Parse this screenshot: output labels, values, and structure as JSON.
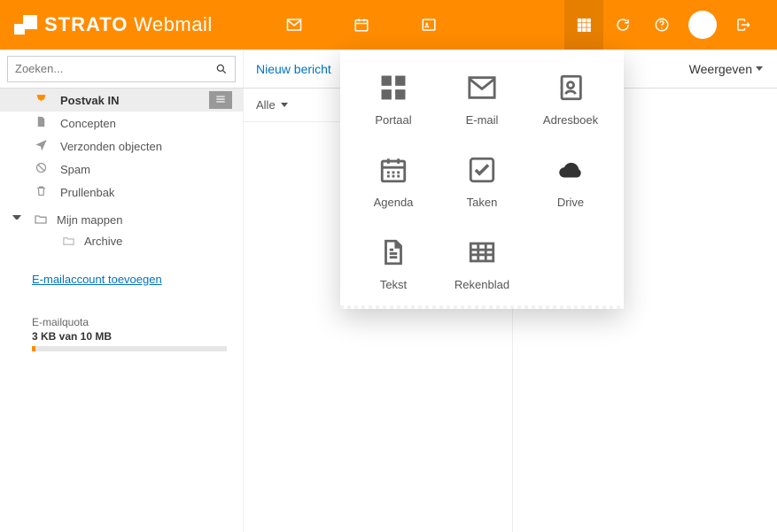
{
  "brand": {
    "strong": "STRATO",
    "light": "Webmail"
  },
  "toolbar": {
    "search_placeholder": "Zoeken...",
    "compose": "Nieuw bericht",
    "view": "Weergeven",
    "filter": "Alle"
  },
  "folders": [
    {
      "id": "inbox",
      "label": "Postvak IN",
      "icon": "inbox",
      "selected": true
    },
    {
      "id": "drafts",
      "label": "Concepten",
      "icon": "file",
      "selected": false
    },
    {
      "id": "sent",
      "label": "Verzonden objecten",
      "icon": "plane",
      "selected": false
    },
    {
      "id": "spam",
      "label": "Spam",
      "icon": "ban",
      "selected": false
    },
    {
      "id": "trash",
      "label": "Prullenbak",
      "icon": "trash",
      "selected": false
    }
  ],
  "tree": {
    "header": "Mijn mappen",
    "children": [
      {
        "label": "Archive"
      }
    ]
  },
  "add_account": "E-mailaccount toevoegen",
  "quota": {
    "title": "E-mailquota",
    "value": "3 KB van 10 MB",
    "percent": 2
  },
  "launcher": [
    {
      "id": "portal",
      "label": "Portaal",
      "icon": "grid4"
    },
    {
      "id": "email",
      "label": "E-mail",
      "icon": "envelope"
    },
    {
      "id": "contacts",
      "label": "Adresboek",
      "icon": "addressbook"
    },
    {
      "id": "agenda",
      "label": "Agenda",
      "icon": "calendar"
    },
    {
      "id": "tasks",
      "label": "Taken",
      "icon": "check"
    },
    {
      "id": "drive",
      "label": "Drive",
      "icon": "cloud"
    },
    {
      "id": "text",
      "label": "Tekst",
      "icon": "document"
    },
    {
      "id": "sheet",
      "label": "Rekenblad",
      "icon": "table"
    }
  ]
}
